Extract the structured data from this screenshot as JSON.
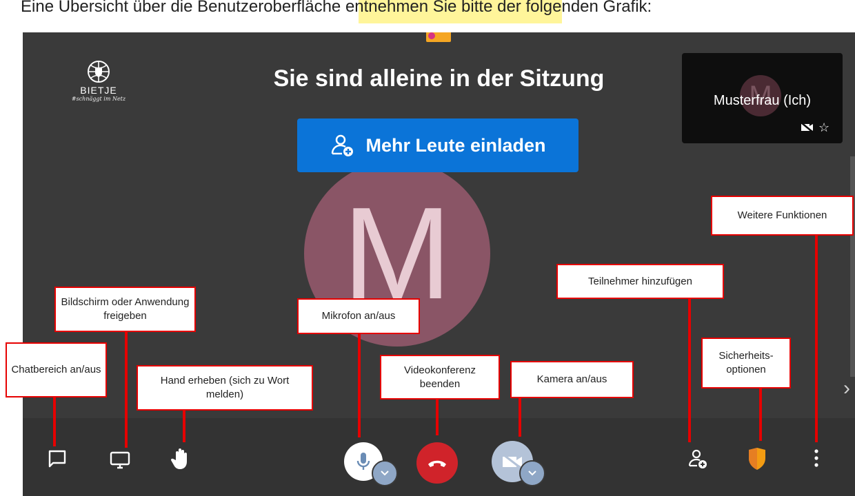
{
  "intro_text": "Eine Übersicht über die Benutzeroberfläche entnehmen Sie bitte der folgenden Grafik:",
  "logo": {
    "name": "BIETJE",
    "tagline": "#schnäggt im Netz"
  },
  "meeting": {
    "title": "Sie sind alleine in der Sitzung",
    "invite_label": "Mehr Leute einladen",
    "avatar_letter": "M"
  },
  "self_view": {
    "name": "Musterfrau (Ich)",
    "avatar_letter": "M"
  },
  "callouts": {
    "chat": "Chatbereich an/aus",
    "screen": "Bildschirm oder Anwendung freigeben",
    "hand": "Hand erheben (sich zu Wort melden)",
    "mic": "Mikrofon an/aus",
    "hangup": "Videokonferenz beenden",
    "camera": "Kamera an/aus",
    "participants": "Teilnehmer hinzufügen",
    "security": "Sicherheits-optionen",
    "more": "Weitere Funktionen"
  },
  "colors": {
    "stage_bg": "#3a3a3a",
    "invite_bg": "#0b74d8",
    "avatar_bg": "#8a5566",
    "hangup_red": "#d0232a",
    "security_orange": "#f39c12",
    "callout_border": "#e60000"
  },
  "icons": [
    "chat-icon",
    "screen-share-icon",
    "hand-icon",
    "microphone-icon",
    "hangup-icon",
    "camera-off-icon",
    "add-participant-icon",
    "shield-icon",
    "more-vertical-icon"
  ]
}
